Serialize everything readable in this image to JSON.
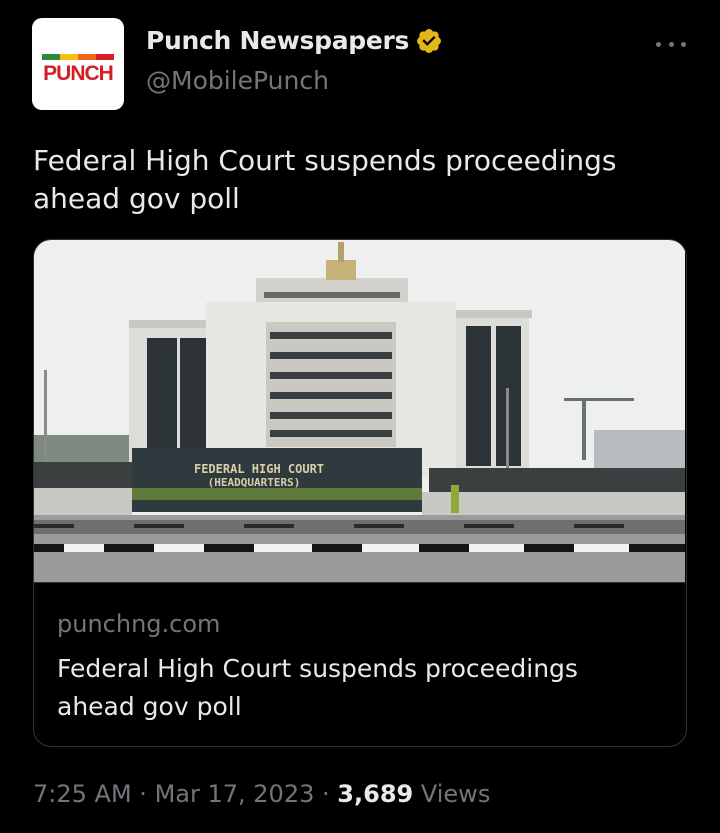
{
  "author": {
    "avatar_logo_text": "PUNCH",
    "display_name": "Punch Newspapers",
    "handle": "@MobilePunch",
    "verified_icon": "verified-badge-gold",
    "verified_color": "#e2b719"
  },
  "tweet": {
    "text": "Federal High Court suspends proceedings ahead gov poll"
  },
  "link_card": {
    "image_sign_line1": "FEDERAL HIGH COURT",
    "image_sign_line2": "(HEADQUARTERS)",
    "domain": "punchng.com",
    "title": "Federal High Court suspends proceedings ahead gov poll"
  },
  "meta": {
    "time": "7:25 AM",
    "separator": "·",
    "date": "Mar 17, 2023",
    "views_count": "3,689",
    "views_label": "Views"
  },
  "colors": {
    "background": "#000000",
    "primary_text": "#e7e9ea",
    "secondary_text": "#71767b",
    "border": "#2f3336",
    "punch_red": "#d41f26"
  }
}
